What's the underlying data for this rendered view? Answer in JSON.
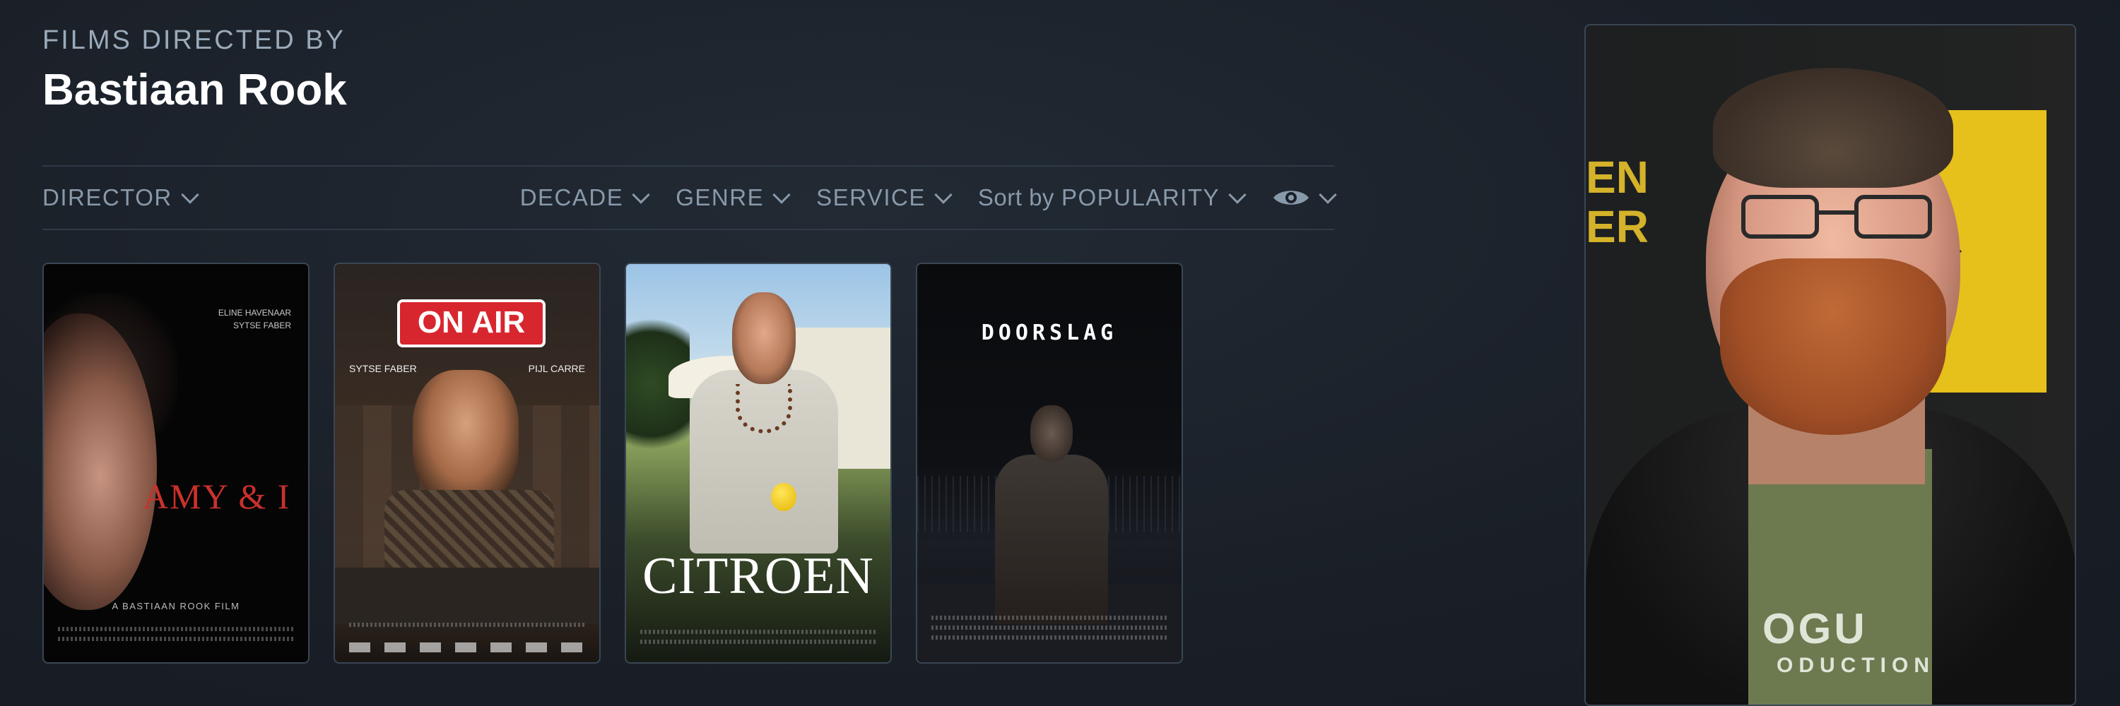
{
  "header": {
    "eyebrow": "FILMS DIRECTED BY",
    "title": "Bastiaan Rook"
  },
  "filters": {
    "director": "DIRECTOR",
    "decade": "DECADE",
    "genre": "GENRE",
    "service": "SERVICE",
    "sort_prefix": "Sort by",
    "sort_value": "POPULARITY",
    "visibility_icon": "eye-icon"
  },
  "posters": [
    {
      "title": "AMY & I",
      "cast": [
        "ELINE HAVENAAR",
        "SYTSE FABER"
      ],
      "tagline": "A BASTIAAN ROOK FILM"
    },
    {
      "badge": "ON AIR",
      "cast_left": "SYTSE FABER",
      "cast_right": "PIJL CARRE"
    },
    {
      "title": "CITROEN"
    },
    {
      "title": "DOORSLAG"
    }
  ],
  "photo": {
    "shirt_text": "OGU",
    "shirt_subtext": "ODUCTION",
    "bg_letters": "EN\nER"
  },
  "colors": {
    "background": "#1b2028",
    "title": "#ffffff",
    "muted": "#8899aa",
    "divider": "#2f3a46"
  }
}
